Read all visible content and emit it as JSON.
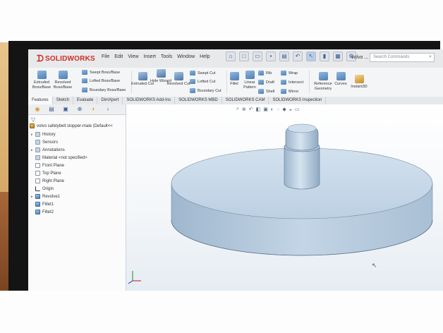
{
  "app": {
    "logo_text": "SOLIDWORKS",
    "menu": [
      "File",
      "Edit",
      "View",
      "Insert",
      "Tools",
      "Window",
      "Help"
    ],
    "filename": "volvo ...",
    "search_placeholder": "Search Commands"
  },
  "ribbon": {
    "extruded_boss": "Extruded Boss/Base",
    "revolved_boss": "Revolved Boss/Base",
    "swept_boss": "Swept Boss/Base",
    "lofted_boss": "Lofted Boss/Base",
    "boundary_boss": "Boundary Boss/Base",
    "extruded_cut": "Extruded Cut",
    "hole_wizard": "Hole Wizard",
    "revolved_cut": "Revolved Cut",
    "swept_cut": "Swept Cut",
    "lofted_cut": "Lofted Cut",
    "boundary_cut": "Boundary Cut",
    "fillet": "Fillet",
    "linear_pattern": "Linear Pattern",
    "rib": "Rib",
    "draft": "Draft",
    "shell": "Shell",
    "wrap": "Wrap",
    "intersect": "Intersect",
    "mirror": "Mirror",
    "reference_geometry": "Reference Geometry",
    "curves": "Curves",
    "instant3d": "Instant3D"
  },
  "tabs": [
    "Features",
    "Sketch",
    "Evaluate",
    "DimXpert",
    "SOLIDWORKS Add-Ins",
    "SOLIDWORKS MBD",
    "SOLIDWORKS CAM",
    "SOLIDWORKS Inspection"
  ],
  "active_tab": "Features",
  "tree": {
    "root": "volvo safetybelt stopper-male (Default<<",
    "items": [
      {
        "label": "History",
        "icon": "history-icon"
      },
      {
        "label": "Sensors",
        "icon": "sensors-icon"
      },
      {
        "label": "Annotations",
        "icon": "annotations-icon"
      },
      {
        "label": "Material <not specified>",
        "icon": "material-icon"
      },
      {
        "label": "Front Plane",
        "icon": "plane-icon"
      },
      {
        "label": "Top Plane",
        "icon": "plane-icon"
      },
      {
        "label": "Right Plane",
        "icon": "plane-icon"
      },
      {
        "label": "Origin",
        "icon": "origin-icon"
      },
      {
        "label": "Revolve1",
        "icon": "revolve-icon"
      },
      {
        "label": "Fillet1",
        "icon": "fillet-icon"
      },
      {
        "label": "Fillet2",
        "icon": "fillet-icon"
      }
    ]
  },
  "colors": {
    "brand": "#d02a26",
    "model_face": "#c7d9ea",
    "model_side": "#b3c8dc",
    "model_edge": "#5a7088"
  }
}
